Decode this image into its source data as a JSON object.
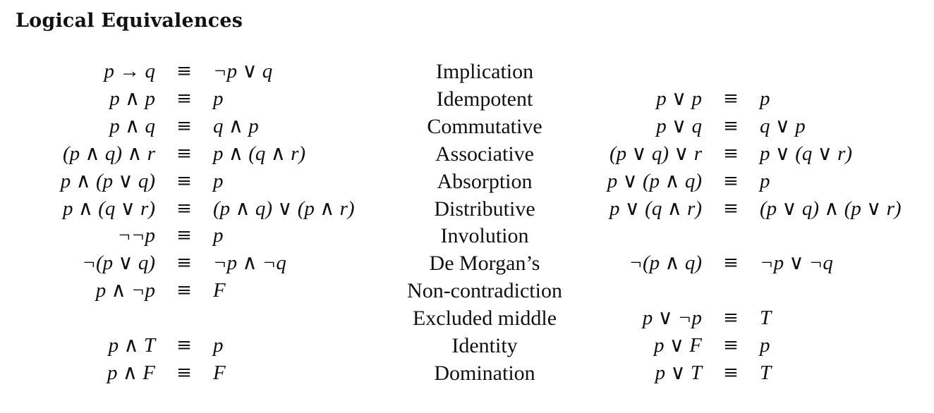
{
  "title": "Logical Equivalences",
  "equivalence_symbol": "≡",
  "rows": [
    {
      "law": "Implication",
      "left": {
        "lhs": "p → q",
        "rhs": "¬p ∨ q"
      },
      "right": {
        "lhs": "",
        "rhs": ""
      }
    },
    {
      "law": "Idempotent",
      "left": {
        "lhs": "p ∧ p",
        "rhs": "p"
      },
      "right": {
        "lhs": "p ∨ p",
        "rhs": "p"
      }
    },
    {
      "law": "Commutative",
      "left": {
        "lhs": "p ∧ q",
        "rhs": "q ∧ p"
      },
      "right": {
        "lhs": "p ∨ q",
        "rhs": "q ∨ p"
      }
    },
    {
      "law": "Associative",
      "left": {
        "lhs": "(p ∧ q) ∧ r",
        "rhs": "p ∧ (q ∧ r)"
      },
      "right": {
        "lhs": "(p ∨ q) ∨ r",
        "rhs": "p ∨ (q ∨ r)"
      }
    },
    {
      "law": "Absorption",
      "left": {
        "lhs": "p ∧ (p ∨ q)",
        "rhs": "p"
      },
      "right": {
        "lhs": "p ∨ (p ∧ q)",
        "rhs": "p"
      }
    },
    {
      "law": "Distributive",
      "left": {
        "lhs": "p ∧ (q ∨ r)",
        "rhs": "(p ∧ q) ∨ (p ∧ r)"
      },
      "right": {
        "lhs": "p ∨ (q ∧ r)",
        "rhs": "(p ∨ q) ∧ (p ∨ r)"
      }
    },
    {
      "law": "Involution",
      "left": {
        "lhs": "¬¬p",
        "rhs": "p"
      },
      "right": {
        "lhs": "",
        "rhs": ""
      }
    },
    {
      "law": "De Morgan’s",
      "left": {
        "lhs": "¬(p ∨ q)",
        "rhs": "¬p ∧ ¬q"
      },
      "right": {
        "lhs": "¬(p ∧ q)",
        "rhs": "¬p ∨ ¬q"
      }
    },
    {
      "law": "Non-contradiction",
      "left": {
        "lhs": "p ∧ ¬p",
        "rhs": "F"
      },
      "right": {
        "lhs": "",
        "rhs": ""
      }
    },
    {
      "law": "Excluded middle",
      "left": {
        "lhs": "",
        "rhs": ""
      },
      "right": {
        "lhs": "p ∨ ¬p",
        "rhs": "T"
      }
    },
    {
      "law": "Identity",
      "left": {
        "lhs": "p ∧ T",
        "rhs": "p"
      },
      "right": {
        "lhs": "p ∨ F",
        "rhs": "p"
      }
    },
    {
      "law": "Domination",
      "left": {
        "lhs": "p ∧ F",
        "rhs": "F"
      },
      "right": {
        "lhs": "p ∨ T",
        "rhs": "T"
      }
    }
  ]
}
